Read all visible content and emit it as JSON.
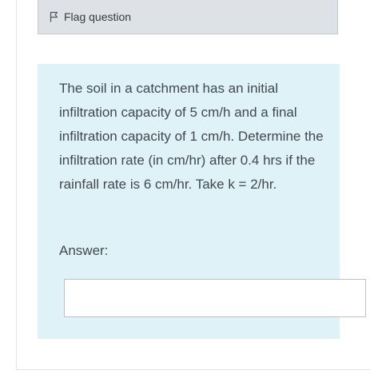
{
  "flag": {
    "label": "Flag question",
    "icon": "flag-outline-icon"
  },
  "question": {
    "text": "The soil in a catchment has an initial infiltration capacity of 5 cm/h and a final infiltration capacity of 1 cm/h. Determine the infiltration rate (in cm/hr) after 0.4 hrs if the rainfall rate is 6 cm/hr. Take k = 2/hr.",
    "answer_label": "Answer:",
    "answer_value": ""
  },
  "colors": {
    "question_background": "#def2f8",
    "flag_panel_background": "#dee2e6"
  }
}
